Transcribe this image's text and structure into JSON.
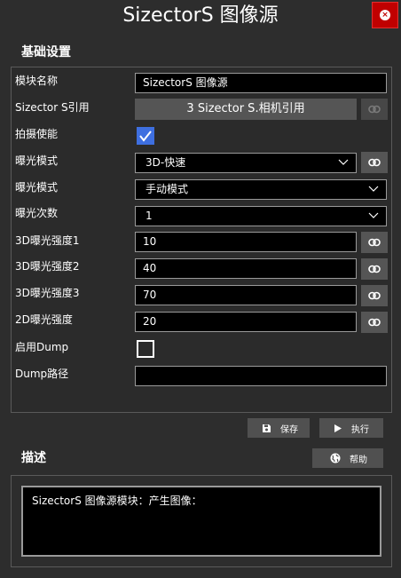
{
  "window": {
    "title": "SizectorS 图像源"
  },
  "basic_settings": {
    "title": "基础设置",
    "module_name": {
      "label": "模块名称",
      "value": "SizectorS 图像源"
    },
    "sizector_ref": {
      "label": "Sizector S引用",
      "value": "3 Sizector S.相机引用"
    },
    "capture_enable": {
      "label": "拍摄使能",
      "checked": true
    },
    "exposure_mode_1": {
      "label": "曝光模式",
      "value": "3D-快速"
    },
    "exposure_mode_2": {
      "label": "曝光模式",
      "value": "手动模式"
    },
    "exposure_count": {
      "label": "曝光次数",
      "value": "1"
    },
    "exposure_3d_1": {
      "label": "3D曝光强度1",
      "value": "10"
    },
    "exposure_3d_2": {
      "label": "3D曝光强度2",
      "value": "40"
    },
    "exposure_3d_3": {
      "label": "3D曝光强度3",
      "value": "70"
    },
    "exposure_2d": {
      "label": "2D曝光强度",
      "value": "20"
    },
    "enable_dump": {
      "label": "启用Dump",
      "checked": false
    },
    "dump_path": {
      "label": "Dump路径",
      "value": ""
    }
  },
  "actions": {
    "save_label": "保存",
    "run_label": "执行",
    "help_label": "帮助"
  },
  "description": {
    "title": "描述",
    "text": "SizectorS 图像源模块：产生图像："
  },
  "colors": {
    "background": "#2d2d2d",
    "close_button": "#c00000",
    "checkbox_accent": "#3e6fe0",
    "button": "#555555"
  }
}
